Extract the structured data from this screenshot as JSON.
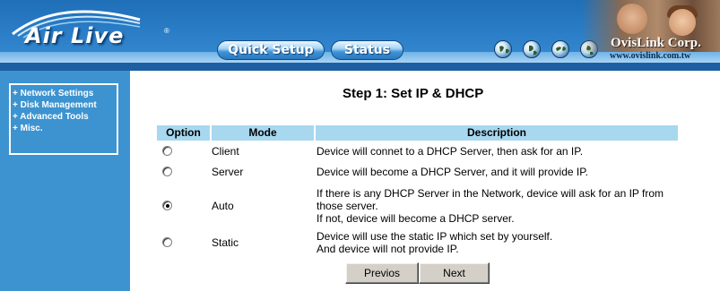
{
  "header": {
    "logo": "Air Live",
    "logo_mark": "®",
    "nav": [
      {
        "label": "Quick Setup"
      },
      {
        "label": "Status"
      }
    ],
    "globe_icons": [
      "globe-icon",
      "globe-icon",
      "globe-icon",
      "globe-icon"
    ],
    "company": "OvisLink Corp.",
    "url": "www.ovislink.com.tw"
  },
  "sidebar": {
    "items": [
      {
        "label": "+ Network Settings"
      },
      {
        "label": "+ Disk Management"
      },
      {
        "label": "+ Advanced Tools"
      },
      {
        "label": "+ Misc."
      }
    ]
  },
  "main": {
    "title": "Step 1: Set IP & DHCP",
    "columns": [
      "Option",
      "Mode",
      "Description"
    ],
    "rows": [
      {
        "mode": "Client",
        "selected": false,
        "description": [
          "Device will connet to a DHCP Server, then ask for an IP."
        ]
      },
      {
        "mode": "Server",
        "selected": false,
        "description": [
          "Device will become a DHCP Server, and it will provide IP."
        ]
      },
      {
        "mode": "Auto",
        "selected": true,
        "description": [
          "If there is any DHCP Server in the Network, device will ask for an IP from",
          "those server.",
          "If not, device will become a DHCP server."
        ]
      },
      {
        "mode": "Static",
        "selected": false,
        "description": [
          "Device will use the static IP which set by yourself.",
          "And device will not provide IP."
        ]
      }
    ],
    "buttons": {
      "previous": "Previos",
      "next": "Next"
    }
  },
  "colors": {
    "header_blue": "#2a7dc6",
    "sidebar_blue": "#3c93d0",
    "table_header": "#a7d8ef",
    "button_face": "#d4d0c8"
  }
}
